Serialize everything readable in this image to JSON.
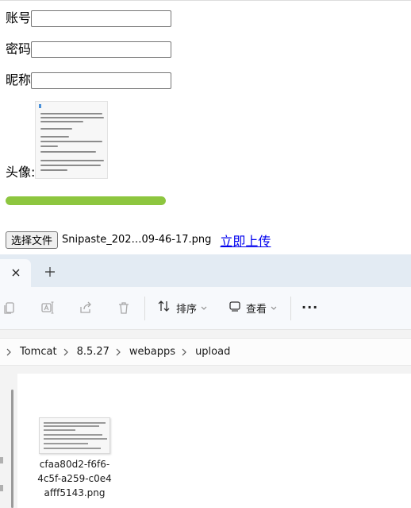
{
  "form": {
    "account_label": "账号",
    "password_label": "密码",
    "nickname_label": "昵称",
    "account_value": "",
    "password_value": "",
    "nickname_value": "",
    "avatar_label": "头像:",
    "upload_progress": 1.0,
    "progress_color": "#8dc63f",
    "file_button_label": "选择文件",
    "file_name": "Snipaste_202…09-46-17.png",
    "upload_link": "立即上传"
  },
  "explorer": {
    "tab_close_icon": "close-icon",
    "new_tab_icon": "plus-icon",
    "toolbar": {
      "copy_icon": "copy-icon",
      "rename_icon": "rename-icon",
      "share_icon": "share-icon",
      "delete_icon": "trash-icon",
      "sort_label": "排序",
      "view_label": "查看",
      "more_label": "···"
    },
    "breadcrumb": [
      "Tomcat",
      "8.5.27",
      "webapps",
      "upload"
    ],
    "file": {
      "name": "cfaa80d2-f6f6-4c5f-a259-c0e4afff5143.png"
    }
  }
}
